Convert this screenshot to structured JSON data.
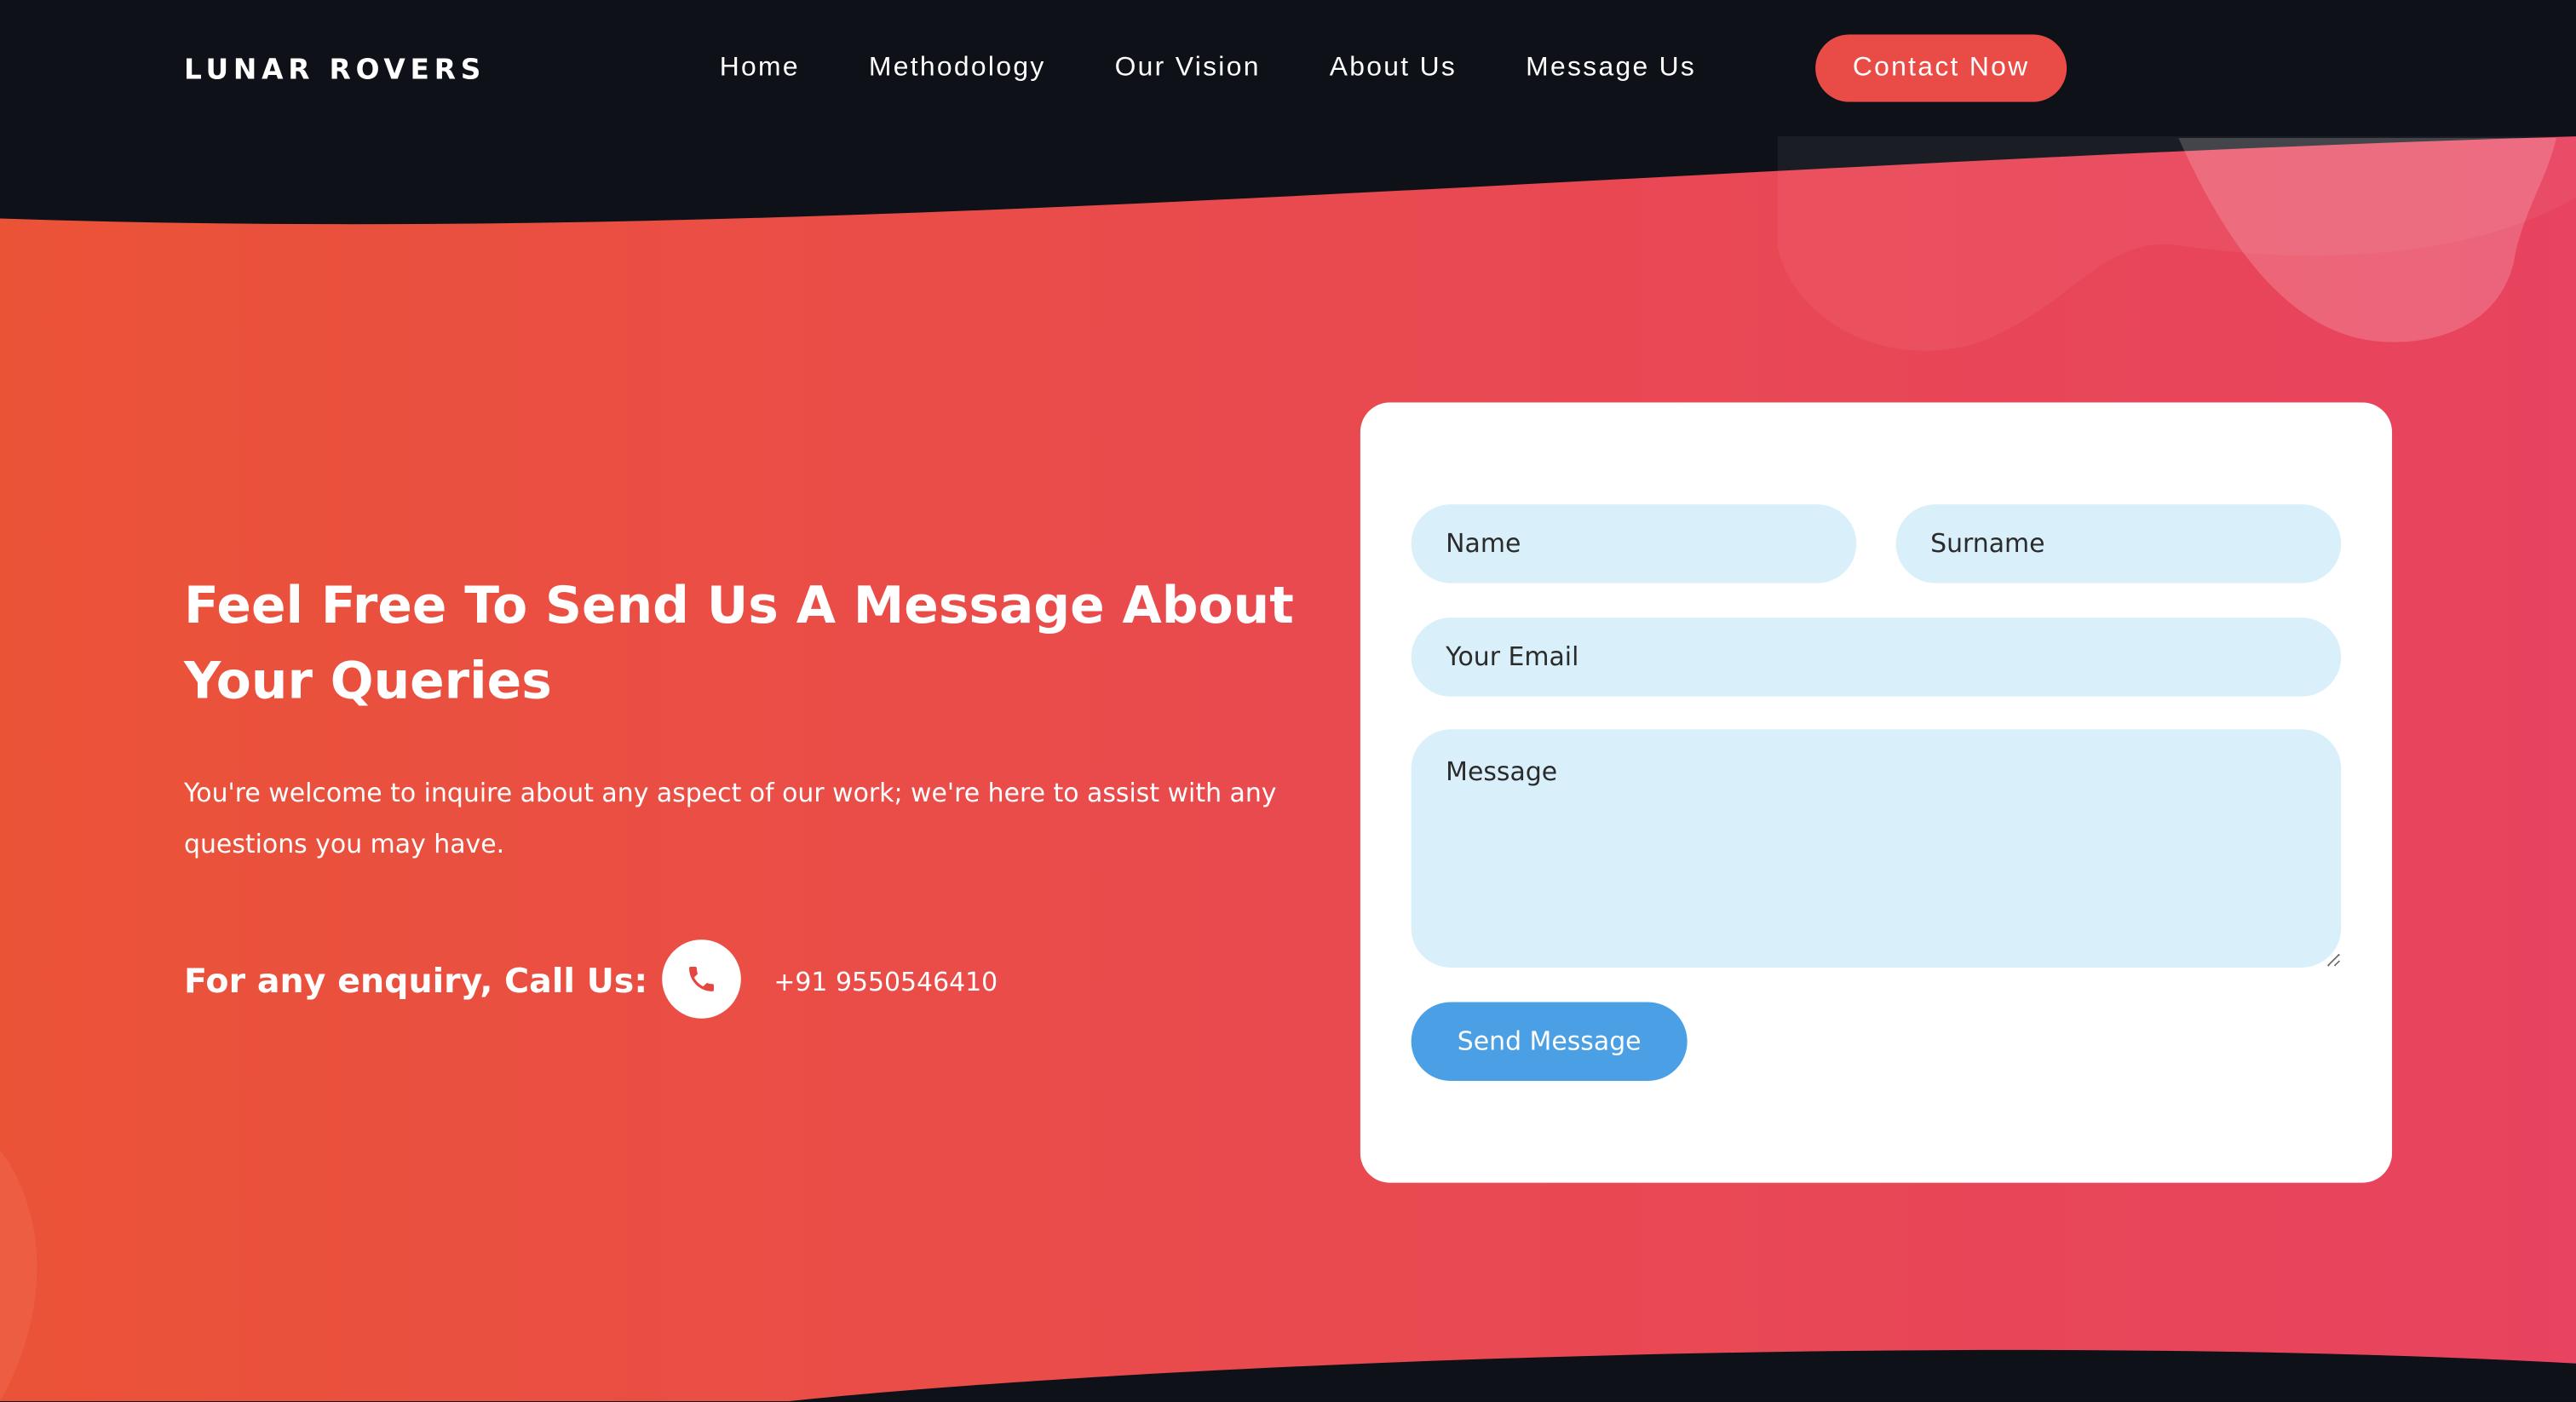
{
  "brand": {
    "logo_text": "LUNAR ROVERS"
  },
  "nav": {
    "items": [
      {
        "label": "Home"
      },
      {
        "label": "Methodology"
      },
      {
        "label": "Our Vision"
      },
      {
        "label": "About Us"
      },
      {
        "label": "Message Us"
      }
    ],
    "cta_label": "Contact Now"
  },
  "hero": {
    "heading": "Feel Free To Send Us A Message About Your Queries",
    "subtext": "You're welcome to inquire about any aspect of our work; we're here to assist with any questions you may have.",
    "enquiry_label": "For any enquiry, Call Us:",
    "phone_icon": "phone-icon",
    "phone_number": "+91 9550546410"
  },
  "form": {
    "name_placeholder": "Name",
    "surname_placeholder": "Surname",
    "email_placeholder": "Your Email",
    "message_placeholder": "Message",
    "submit_label": "Send Message"
  },
  "colors": {
    "background_dark": "#0e1118",
    "gradient_start": "#eb5337",
    "gradient_end": "#e8435f",
    "cta": "#e94b46",
    "input_bg": "#d9f0fb",
    "submit": "#4a9fe5",
    "card": "#ffffff"
  }
}
